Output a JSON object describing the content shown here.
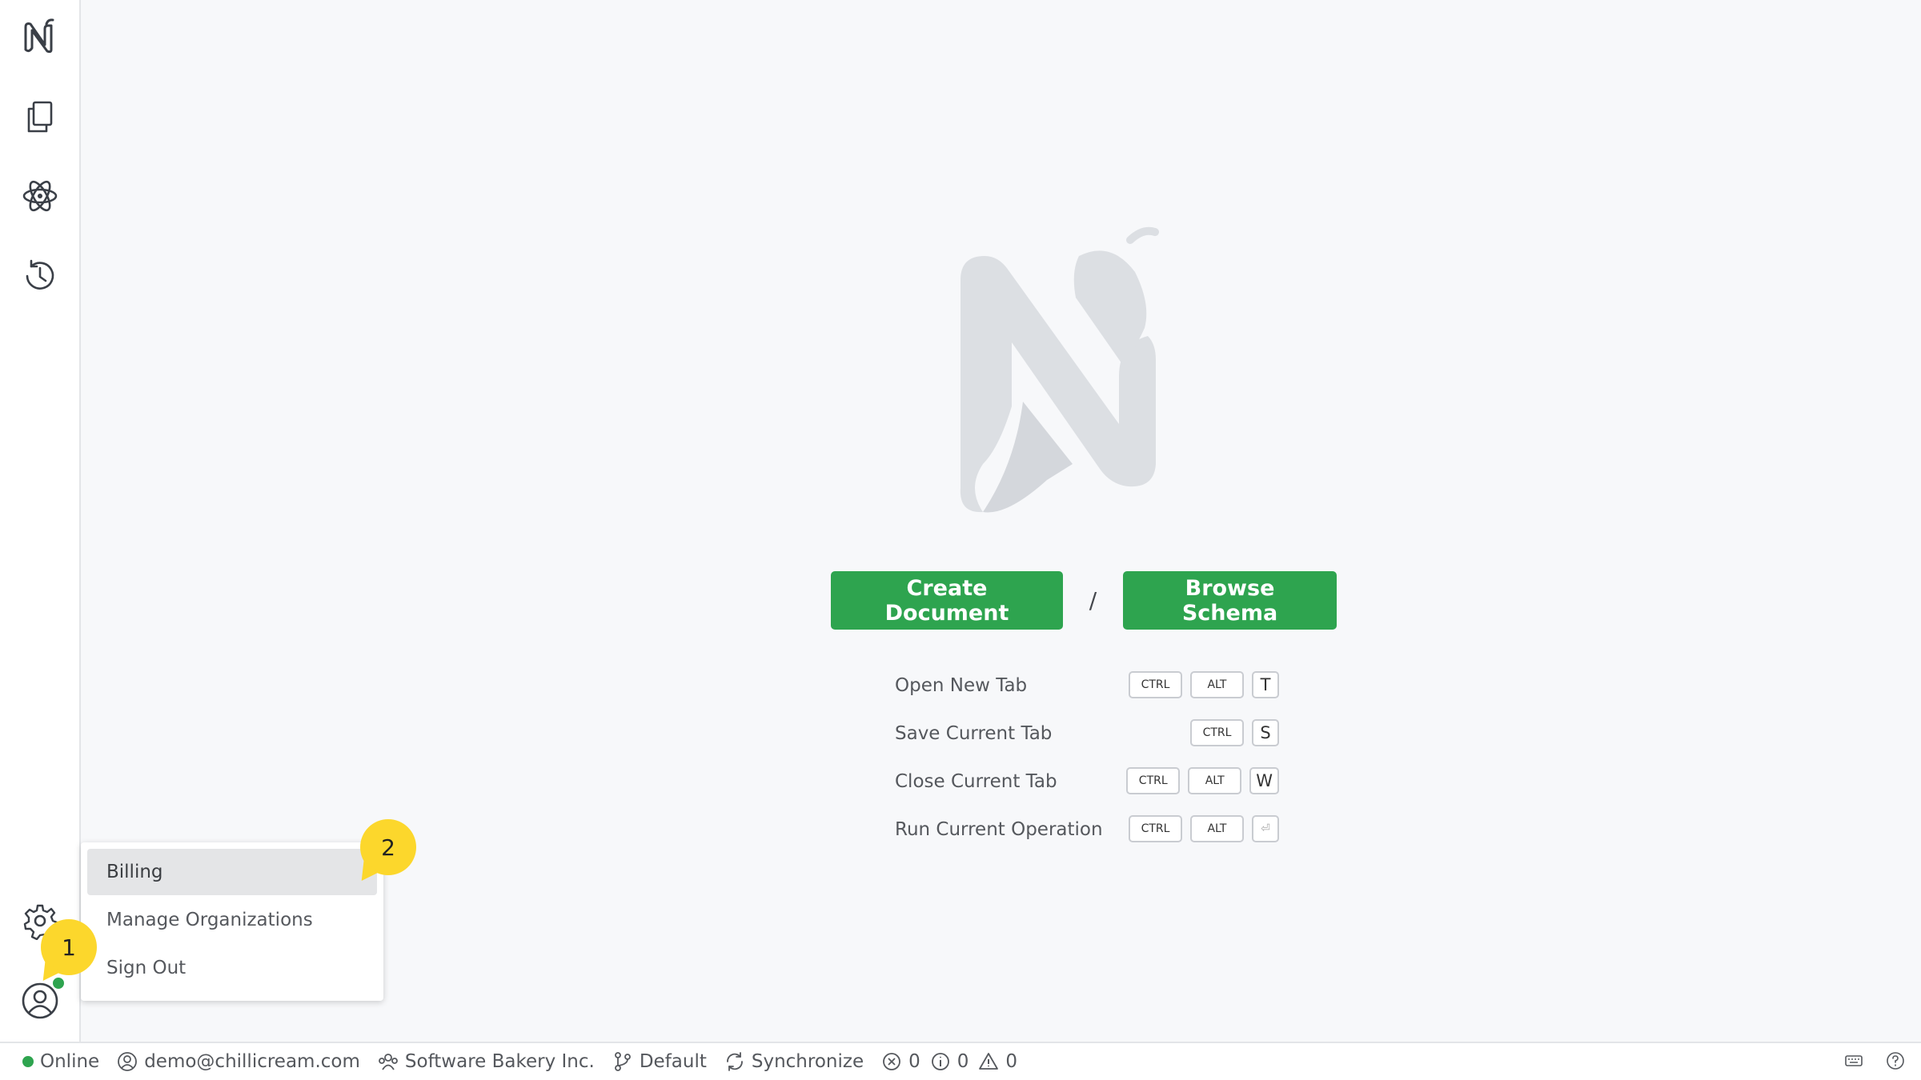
{
  "sidebar": {
    "items": [
      {
        "name": "app-logo",
        "icon": "chillicream-logo-icon"
      },
      {
        "name": "documents",
        "icon": "documents-icon"
      },
      {
        "name": "schema",
        "icon": "atom-icon"
      },
      {
        "name": "history",
        "icon": "history-icon"
      },
      {
        "name": "settings",
        "icon": "gear-icon"
      },
      {
        "name": "account",
        "icon": "user-circle-icon"
      }
    ]
  },
  "main": {
    "create_label": "Create Document",
    "separator": "/",
    "browse_label": "Browse Schema",
    "shortcuts": [
      {
        "label": "Open New Tab",
        "keys": [
          "CTRL",
          "ALT",
          "T"
        ]
      },
      {
        "label": "Save Current Tab",
        "keys": [
          "CTRL",
          "S"
        ]
      },
      {
        "label": "Close Current Tab",
        "keys": [
          "CTRL",
          "ALT",
          "W"
        ]
      },
      {
        "label": "Run Current Operation",
        "keys": [
          "CTRL",
          "ALT",
          "⏎"
        ]
      }
    ]
  },
  "menu": {
    "items": [
      "Billing",
      "Manage Organizations",
      "Sign Out"
    ],
    "active": "Billing"
  },
  "badges": {
    "one": "1",
    "two": "2"
  },
  "status": {
    "online": "Online",
    "email": "demo@chillicream.com",
    "organization": "Software Bakery Inc.",
    "environment": "Default",
    "sync": "Synchronize",
    "errors": "0",
    "infos": "0",
    "warnings": "0"
  },
  "colors": {
    "accent": "#2ea44f",
    "badge": "#fcd72c",
    "logo_watermark": "#dcdfe3"
  }
}
